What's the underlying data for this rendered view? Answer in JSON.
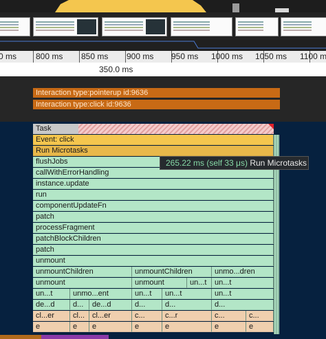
{
  "timeline": {
    "ticks": [
      "0 ms",
      "800 ms",
      "850 ms",
      "900 ms",
      "950 ms",
      "1000 ms",
      "1050 ms",
      "1100 ms"
    ],
    "selection_duration": "350.0 ms"
  },
  "interactions": [
    {
      "label": "Interaction type:pointerup id:9636"
    },
    {
      "label": "Interaction type:click id:9636"
    }
  ],
  "flame": {
    "task": "Task",
    "event_click": "Event: click",
    "run_microtasks": "Run Microtasks",
    "rows": [
      "flushJobs",
      "callWithErrorHandling",
      "instance.update",
      "run",
      "componentUpdateFn",
      "patch",
      "processFragment",
      "patchBlockChildren",
      "patch",
      "unmount"
    ],
    "unmount_children_row": [
      "unmountChildren",
      "unmountChildren",
      "unmo...dren"
    ],
    "unmount_row": [
      "unmount",
      "unmount",
      "un...t",
      "un...t"
    ],
    "row_un": [
      "un...t",
      "unmo...ent",
      "un...t",
      "un...t",
      "un...t"
    ],
    "row_de": [
      "de...d",
      "d...",
      "de...d",
      "d...",
      "d...",
      "d..."
    ],
    "row_cl": [
      "cl...er",
      "cl...",
      "cl...er",
      "c...",
      "c...r",
      "c...",
      "c..."
    ],
    "row_e": [
      "e",
      "e",
      "e",
      "e",
      "e",
      "e",
      "e"
    ]
  },
  "tooltip": {
    "time": "265.22 ms (self 33 μs)",
    "label": "Run Microtasks"
  },
  "colors": {
    "task_gray": "#c8c8c8",
    "event_yellow": "#f4c64e",
    "js_green": "#b3e6c7",
    "gc_peach": "#efcfae",
    "interaction_orange": "#c86a15",
    "tooltip_time_green": "#86d9a6"
  }
}
